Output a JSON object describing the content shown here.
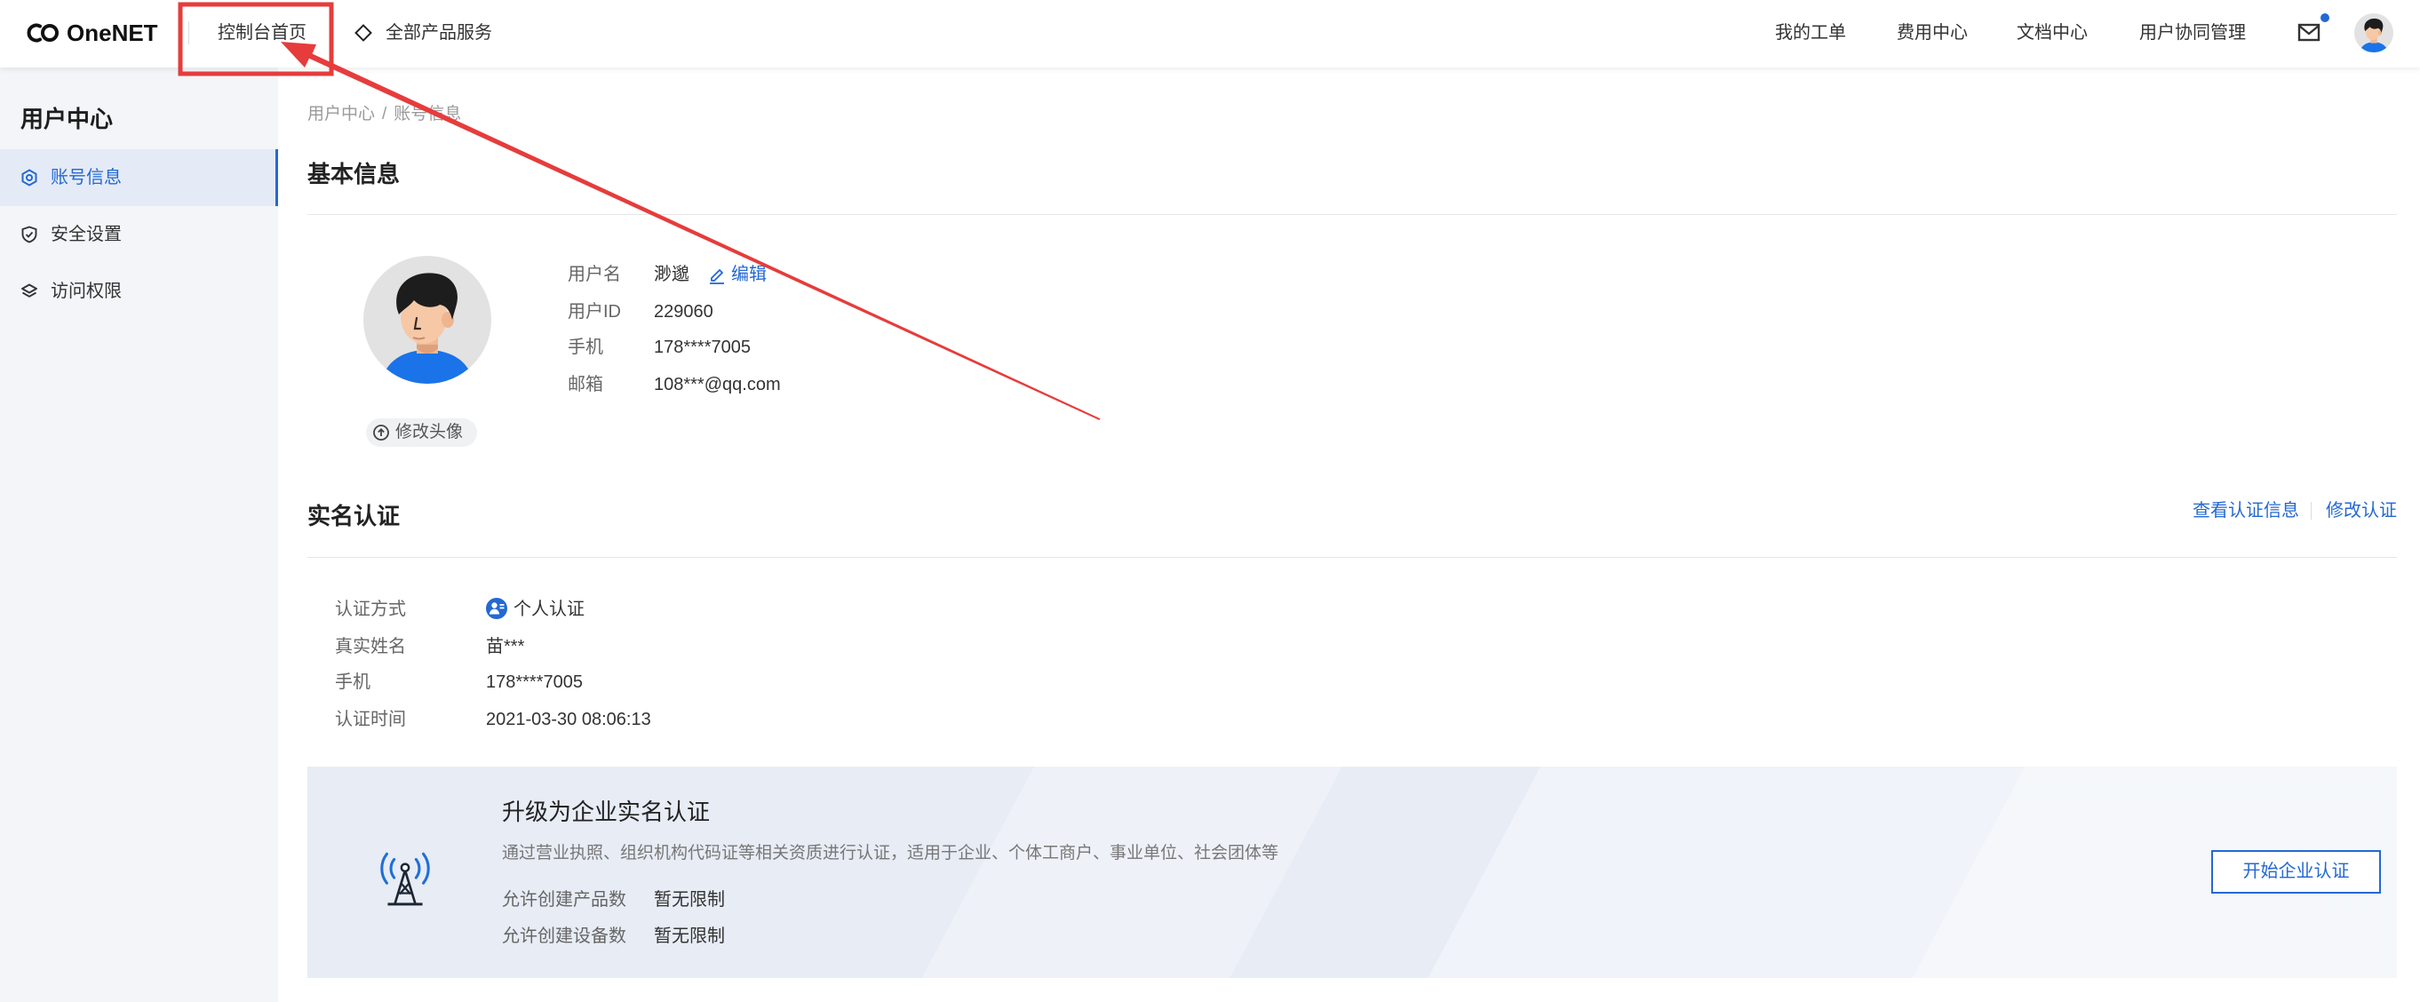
{
  "colors": {
    "accent": "#2468d3",
    "sidebar_bg": "#f3f5f8",
    "sidebar_active_bg": "#e4ebf6",
    "annotation_red": "#e63c3c",
    "card_bg": "#e7ecf5"
  },
  "topnav": {
    "logo": {
      "icon": "onenet-logo-icon",
      "text": "OneNET"
    },
    "console_home": "控制台首页",
    "all_products": {
      "icon": "diamond-icon",
      "label": "全部产品服务"
    },
    "links": [
      "我的工单",
      "费用中心",
      "文档中心",
      "用户协同管理"
    ],
    "mail_icon": "mail-icon",
    "has_unread": true,
    "avatar_icon": "user-avatar-icon"
  },
  "sidebar": {
    "title": "用户中心",
    "items": [
      {
        "label": "账号信息",
        "icon": "hexagon-icon",
        "active": true
      },
      {
        "label": "安全设置",
        "icon": "shield-check-icon",
        "active": false
      },
      {
        "label": "访问权限",
        "icon": "layers-icon",
        "active": false
      }
    ]
  },
  "breadcrumb": {
    "root": "用户中心",
    "separator": "/",
    "current": "账号信息"
  },
  "basic_info": {
    "title": "基本信息",
    "change_avatar": "修改头像",
    "edit_label": "编辑",
    "fields": [
      {
        "label": "用户名",
        "value": "渺邈"
      },
      {
        "label": "用户ID",
        "value": "229060"
      },
      {
        "label": "手机",
        "value": "178****7005"
      },
      {
        "label": "邮箱",
        "value": "108***@qq.com"
      }
    ]
  },
  "realname": {
    "title": "实名认证",
    "view_link": "查看认证信息",
    "modify_link": "修改认证",
    "fields": [
      {
        "label": "认证方式",
        "value": "个人认证",
        "icon": "personal-cert-icon"
      },
      {
        "label": "真实姓名",
        "value": "苗***"
      },
      {
        "label": "手机",
        "value": "178****7005"
      },
      {
        "label": "认证时间",
        "value": "2021-03-30 08:06:13"
      }
    ]
  },
  "enterprise_upgrade": {
    "icon": "antenna-tower-icon",
    "title": "升级为企业实名认证",
    "description": "通过营业执照、组织机构代码证等相关资质进行认证，适用于企业、个体工商户、事业单位、社会团体等",
    "limits": [
      {
        "label": "允许创建产品数",
        "value": "暂无限制"
      },
      {
        "label": "允许创建设备数",
        "value": "暂无限制"
      }
    ],
    "button": "开始企业认证"
  }
}
